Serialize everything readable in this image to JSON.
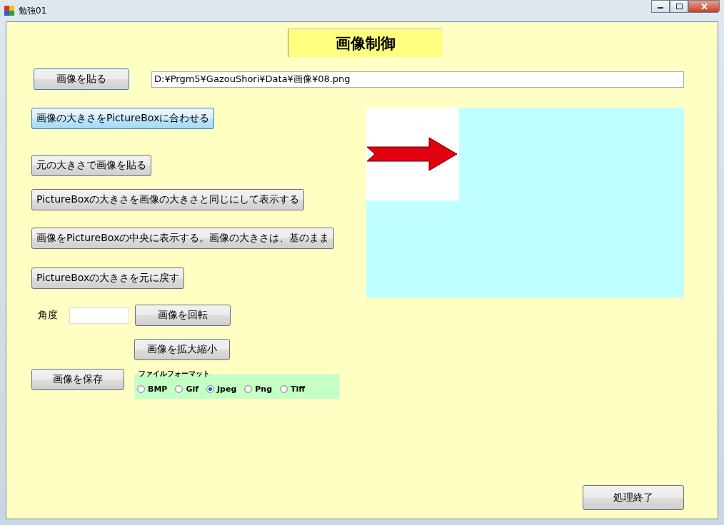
{
  "window": {
    "title": "勉強01"
  },
  "heading": "画像制御",
  "paste_button": "画像を貼る",
  "path_field": {
    "value": "D:¥Prgm5¥GazouShori¥Data¥画像¥08.png"
  },
  "action_buttons": [
    {
      "label": "画像の大きさをPictureBoxに合わせる",
      "highlighted": true
    },
    {
      "label": "元の大きさで画像を貼る",
      "highlighted": false
    },
    {
      "label": "PictureBoxの大きさを画像の大きさと同じにして表示する",
      "highlighted": false
    },
    {
      "label": "画像をPictureBoxの中央に表示する。画像の大きさは、基のまま",
      "highlighted": false
    },
    {
      "label": "PictureBoxの大きさを元に戻す",
      "highlighted": false
    }
  ],
  "angle": {
    "label": "角度",
    "rotate_button": "画像を回転"
  },
  "scale_button": "画像を拡大縮小",
  "save_button": "画像を保存",
  "file_format": {
    "title": "ファイルフォーマット",
    "options": [
      {
        "label": "BMP",
        "selected": false
      },
      {
        "label": "Gif",
        "selected": false
      },
      {
        "label": "Jpeg",
        "selected": true
      },
      {
        "label": "Png",
        "selected": false
      },
      {
        "label": "Tiff",
        "selected": false
      }
    ]
  },
  "finish_button": "処理終了"
}
